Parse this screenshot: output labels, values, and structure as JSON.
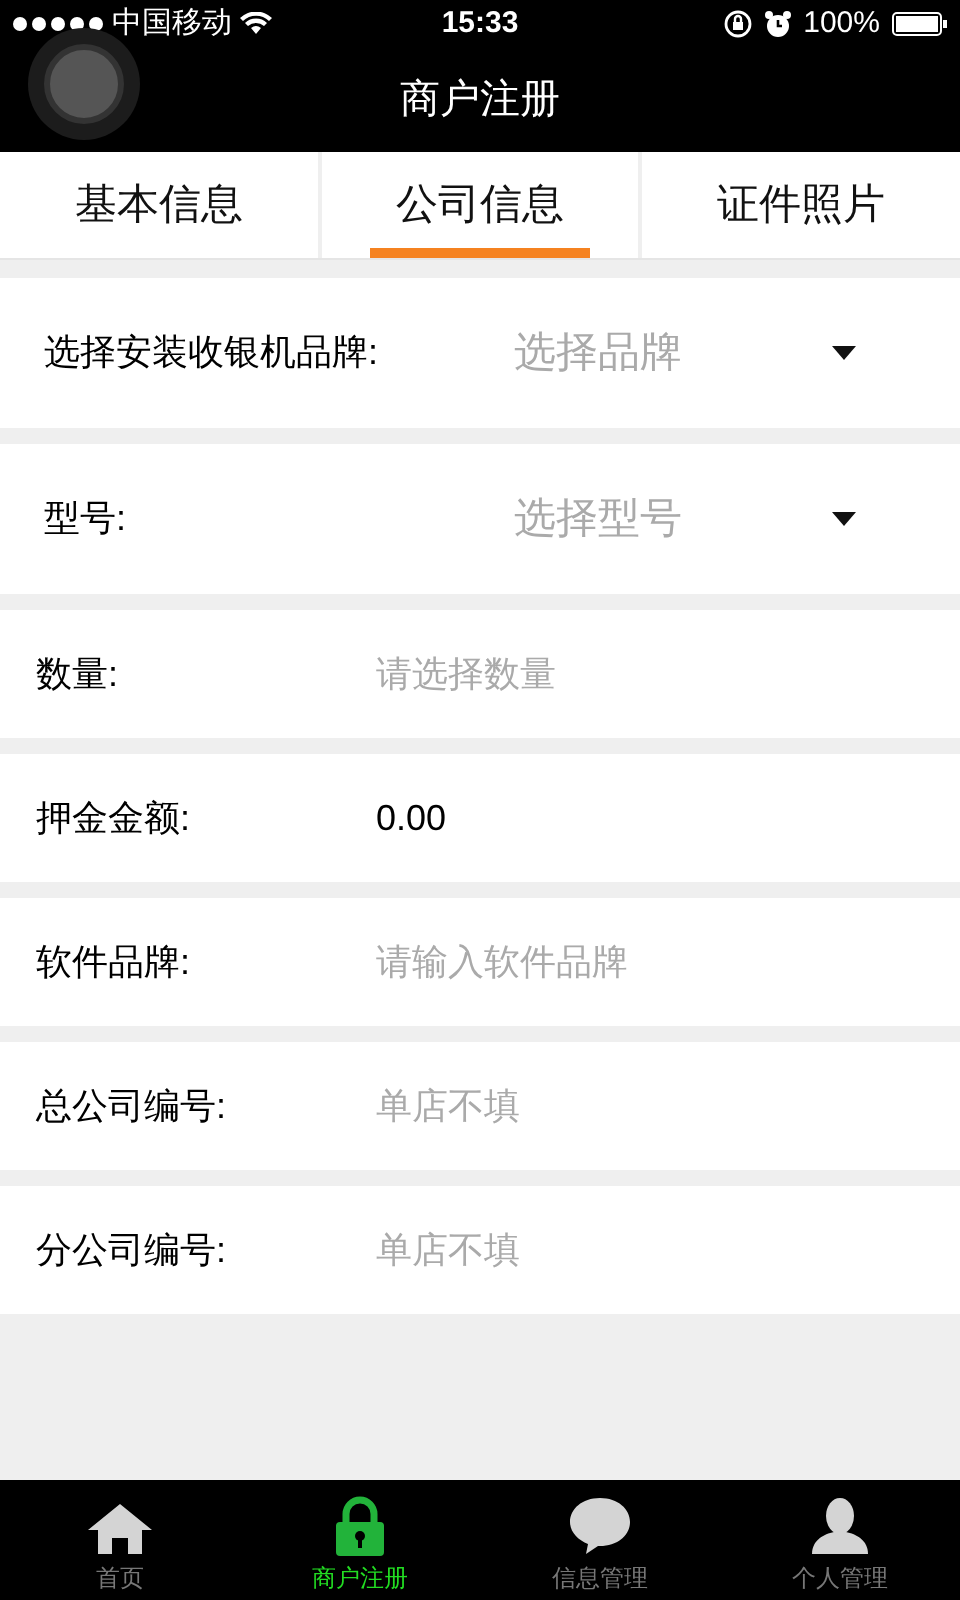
{
  "status_bar": {
    "carrier": "中国移动",
    "time": "15:33",
    "battery": "100%"
  },
  "header": {
    "title": "商户注册"
  },
  "tabs": [
    {
      "label": "基本信息",
      "selected": false
    },
    {
      "label": "公司信息",
      "selected": true
    },
    {
      "label": "证件照片",
      "selected": false
    }
  ],
  "form": [
    {
      "kind": "select",
      "label": "选择安装收银机品牌:",
      "placeholder": "选择品牌"
    },
    {
      "kind": "select",
      "label": "型号:",
      "placeholder": "选择型号"
    },
    {
      "kind": "text",
      "label": "数量:",
      "placeholder": "请选择数量"
    },
    {
      "kind": "text",
      "label": "押金金额:",
      "value": "0.00"
    },
    {
      "kind": "text",
      "label": "软件品牌:",
      "placeholder": "请输入软件品牌"
    },
    {
      "kind": "text",
      "label": "总公司编号:",
      "placeholder": "单店不填"
    },
    {
      "kind": "text",
      "label": "分公司编号:",
      "placeholder": "单店不填"
    }
  ],
  "bottom_nav": [
    {
      "label": "首页",
      "selected": false,
      "kind": "home"
    },
    {
      "label": "商户注册",
      "selected": true,
      "kind": "lock"
    },
    {
      "label": "信息管理",
      "selected": false,
      "kind": "chat"
    },
    {
      "label": "个人管理",
      "selected": false,
      "kind": "user"
    }
  ]
}
